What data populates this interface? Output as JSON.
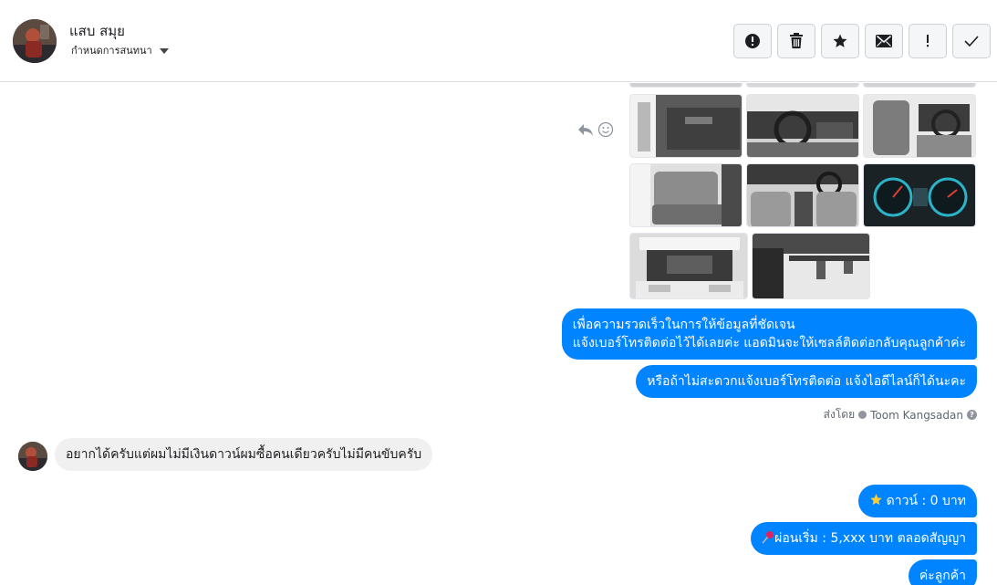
{
  "header": {
    "contact_name": "แสบ สมุย",
    "assign_label": "กำหนดการสนทนา",
    "actions": [
      {
        "name": "report-spam-button",
        "icon": "alert-circle-icon"
      },
      {
        "name": "delete-button",
        "icon": "trash-icon"
      },
      {
        "name": "star-button",
        "icon": "star-icon"
      },
      {
        "name": "mark-unread-button",
        "icon": "envelope-icon"
      },
      {
        "name": "follow-up-button",
        "icon": "exclamation-icon"
      },
      {
        "name": "mark-done-button",
        "icon": "checkmark-icon"
      }
    ]
  },
  "conversation": {
    "messages_out_1": {
      "line1": "เพื่อความรวดเร็วในการให้ข้อมูลที่ชัดเจน",
      "line2": "แจ้งเบอร์โทรติดต่อไว้ได้เลยค่ะ แอดมินจะให้เซลล์ติดต่อกลับคุณลูกค้าค่ะ"
    },
    "messages_out_2": "หรือถ้าไม่สะดวกแจ้งเบอร์โทรติดต่อ แจ้งไอดีไลน์ก็ได้นะคะ",
    "sent_by_label": "ส่งโดย",
    "sent_by_name": "Toom Kangsadan",
    "message_in_1": "อยากได้ครับแต่ผมไม่มีเงินดาวน์ผมซื้อคนเดียวครับไม่มีคนขับครับ",
    "down_payment": "ดาวน์ : 0 บาท",
    "installment": "ผ่อนเริ่ม : 5,xxx บาท ตลอดสัญญา",
    "customer": "ค่ะลูกค้า"
  },
  "photos": [
    {
      "name": "photo-door-panel",
      "subject": "door interior"
    },
    {
      "name": "photo-dashboard-steering",
      "subject": "steering wheel"
    },
    {
      "name": "photo-front-seats",
      "subject": "front seats"
    },
    {
      "name": "photo-rear-seats",
      "subject": "rear seats"
    },
    {
      "name": "photo-cabin-wide",
      "subject": "cabin"
    },
    {
      "name": "photo-gauges",
      "subject": "instrument cluster"
    },
    {
      "name": "photo-engine-bay",
      "subject": "engine"
    },
    {
      "name": "photo-chassis",
      "subject": "underside"
    }
  ],
  "colors": {
    "accent": "#0084ff",
    "incoming_bubble": "#f1f0f0",
    "border": "#dddfe2"
  }
}
